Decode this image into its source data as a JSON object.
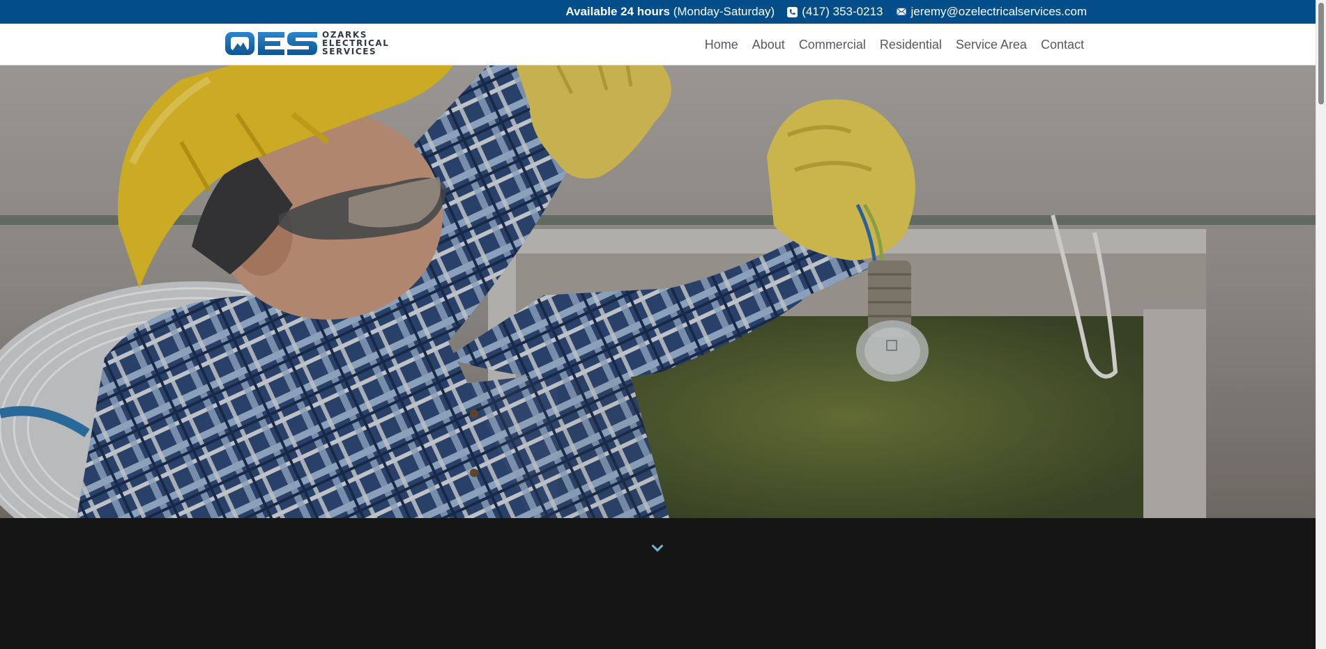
{
  "topbar": {
    "availability_bold": "Available 24 hours",
    "availability_rest": "(Monday-Saturday)",
    "phone": "(417) 353-0213",
    "email": "jeremy@ozelectricalservices.com",
    "phone_icon": "phone-icon",
    "email_icon": "envelope-icon",
    "background": "#024d8a"
  },
  "header": {
    "logo_mark": "OES",
    "logo_lines": [
      "OZARKS",
      "ELECTRICAL",
      "SERVICES"
    ],
    "nav": [
      "Home",
      "About",
      "Commercial",
      "Residential",
      "Service Area",
      "Contact"
    ]
  },
  "hero": {
    "image_subject": "electrician in hard hat and plaid shirt installing a light bulb"
  },
  "colors": {
    "brand_blue": "#024d8a",
    "logo_blue": "#1c6db3",
    "dark_section": "#151515"
  }
}
